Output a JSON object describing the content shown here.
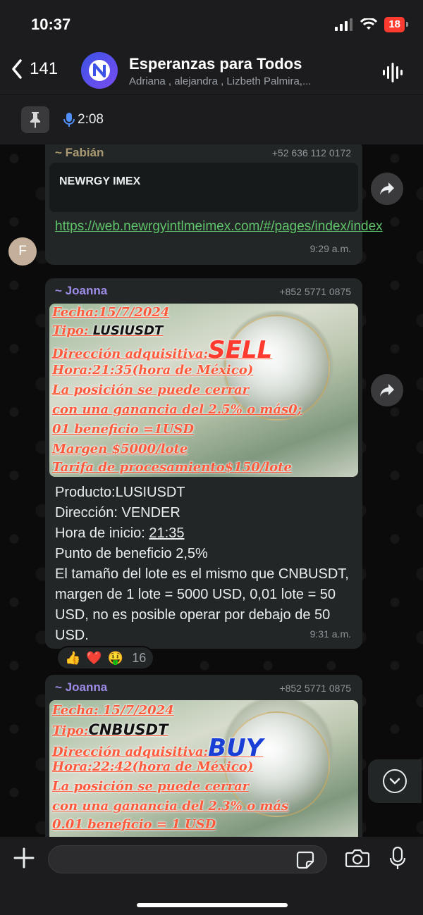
{
  "status_bar": {
    "time": "10:37",
    "battery": "18"
  },
  "header": {
    "back_count": "141",
    "title": "Esperanzas para Todos",
    "members": "Adriana , alejandra , Lizbeth Palmira,..."
  },
  "pinned": {
    "audio_duration": "2:08"
  },
  "messages": [
    {
      "sender": "~ Fabián",
      "phone": "+52 636 112 0172",
      "preview_title": "NEWRGY IMEX",
      "link": "https://web.newrgyintlmeimex.com/#/pages/index/index",
      "time": "9:29 a.m.",
      "avatar_letter": "F"
    },
    {
      "sender": "~ Joanna",
      "phone": "+852 5771 0875",
      "image": {
        "fecha_label": "Fecha:",
        "fecha_value": "15/7/2024",
        "tipo_label": "Tipo:",
        "tipo_value": "LUSIUSDT",
        "direccion_label": "Dirección adquisitiva:",
        "direccion_value": "SELL",
        "hora_label": "Hora:",
        "hora_value": "21:35",
        "hora_suffix": "(hora de México)",
        "line5": "La posición se puede cerrar",
        "line6": "con una ganancia del 2.5% o más0;",
        "line7": "01 beneficio =1USD",
        "line8": "Margen $5000/lote",
        "line9": "Tarifa de procesamiento$150/lote"
      },
      "body": {
        "line1": "Producto:LUSIUSDT",
        "line2": "Dirección: VENDER",
        "line3_a": "Hora de inicio: ",
        "line3_b": "21:35",
        "line4": "Punto de beneficio 2,5%",
        "line5": "El tamaño del lote es el mismo que CNBUSDT, margen de 1 lote = 5000 USD, 0,01 lote = 50 USD, no es posible operar por debajo de 50 USD."
      },
      "time": "9:31 a.m.",
      "reactions": {
        "emojis": [
          "👍",
          "❤️",
          "🤑"
        ],
        "count": "16"
      }
    },
    {
      "sender": "~ Joanna",
      "phone": "+852 5771 0875",
      "image": {
        "fecha_label": "Fecha:",
        "fecha_value": "15/7/2024",
        "tipo_label": "Tipo:",
        "tipo_value": "CNBUSDT",
        "direccion_label": "Dirección adquisitiva:",
        "direccion_value": "BUY",
        "hora_label": "Hora:",
        "hora_value": "22:42",
        "hora_suffix": "(hora de México)",
        "line5": "La posición se puede cerrar",
        "line6": "con una ganancia del 2.3% o más",
        "line7": "0.01 beneficio = 1 USD"
      }
    }
  ],
  "input": {
    "value": ""
  },
  "colors": {
    "accent_link": "#5fc46a",
    "sell": "#ff3b2f",
    "buy": "#1a3fd6",
    "name_fabian": "#a99a73",
    "name_joanna": "#9d8de8"
  }
}
